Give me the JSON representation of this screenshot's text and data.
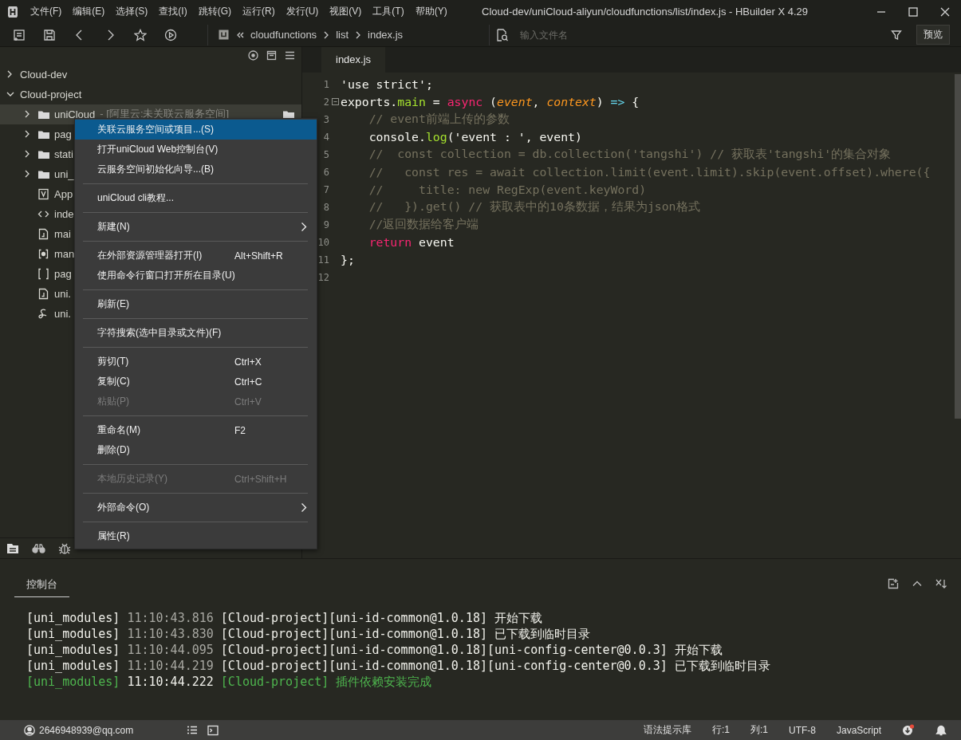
{
  "window": {
    "title": "Cloud-dev/uniCloud-aliyun/cloudfunctions/list/index.js - HBuilder X 4.29"
  },
  "menu_bar": [
    "文件(F)",
    "编辑(E)",
    "选择(S)",
    "查找(I)",
    "跳转(G)",
    "运行(R)",
    "发行(U)",
    "视图(V)",
    "工具(T)",
    "帮助(Y)"
  ],
  "toolbar": {
    "breadcrumb": [
      "cloudfunctions",
      "list",
      "index.js"
    ],
    "search": {
      "placeholder": "输入文件名"
    },
    "preview_button": "预览"
  },
  "tree": [
    {
      "label": "Cloud-dev",
      "expanded": false,
      "selected": false
    },
    {
      "label": "Cloud-project",
      "expanded": true,
      "selected": false,
      "children": [
        {
          "label": "uniCloud",
          "note": "- [阿里云:未关联云服务空间]",
          "kind": "folder",
          "expanded": false,
          "selected": true
        },
        {
          "label": "pag",
          "kind": "folder",
          "expanded": false,
          "selected": false
        },
        {
          "label": "stati",
          "kind": "folder",
          "expanded": false,
          "selected": false
        },
        {
          "label": "uni_",
          "kind": "folder",
          "expanded": false,
          "selected": false
        },
        {
          "label": "App",
          "kind": "vue",
          "selected": false
        },
        {
          "label": "inde",
          "kind": "html",
          "selected": false
        },
        {
          "label": "mai",
          "kind": "js",
          "selected": false
        },
        {
          "label": "man",
          "kind": "manifest",
          "selected": false
        },
        {
          "label": "pag",
          "kind": "json",
          "selected": false
        },
        {
          "label": "uni.",
          "kind": "js",
          "selected": false
        },
        {
          "label": "uni.",
          "kind": "style",
          "selected": false
        }
      ]
    }
  ],
  "context_menu": [
    {
      "kind": "item",
      "label": "关联云服务空间或项目...(S)",
      "submenu": false,
      "disabled": false,
      "selected": true
    },
    {
      "kind": "item",
      "label": "打开uniCloud Web控制台(V)",
      "submenu": false,
      "disabled": false,
      "selected": false
    },
    {
      "kind": "item",
      "label": "云服务空间初始化向导...(B)",
      "submenu": false,
      "disabled": false,
      "selected": false
    },
    {
      "kind": "separator"
    },
    {
      "kind": "item",
      "label": "uniCloud cli教程...",
      "submenu": false,
      "disabled": false,
      "selected": false
    },
    {
      "kind": "separator"
    },
    {
      "kind": "item",
      "label": "新建(N)",
      "submenu": true,
      "disabled": false,
      "selected": false
    },
    {
      "kind": "separator"
    },
    {
      "kind": "item",
      "label": "在外部资源管理器打开(I)",
      "shortcut": "Alt+Shift+R",
      "submenu": false,
      "disabled": false,
      "selected": false
    },
    {
      "kind": "item",
      "label": "使用命令行窗口打开所在目录(U)",
      "submenu": false,
      "disabled": false,
      "selected": false
    },
    {
      "kind": "separator"
    },
    {
      "kind": "item",
      "label": "刷新(E)",
      "submenu": false,
      "disabled": false,
      "selected": false
    },
    {
      "kind": "separator"
    },
    {
      "kind": "item",
      "label": "字符搜索(选中目录或文件)(F)",
      "submenu": false,
      "disabled": false,
      "selected": false
    },
    {
      "kind": "separator"
    },
    {
      "kind": "item",
      "label": "剪切(T)",
      "shortcut": "Ctrl+X",
      "submenu": false,
      "disabled": false,
      "selected": false
    },
    {
      "kind": "item",
      "label": "复制(C)",
      "shortcut": "Ctrl+C",
      "submenu": false,
      "disabled": false,
      "selected": false
    },
    {
      "kind": "item",
      "label": "粘贴(P)",
      "shortcut": "Ctrl+V",
      "submenu": false,
      "disabled": true,
      "selected": false
    },
    {
      "kind": "separator"
    },
    {
      "kind": "item",
      "label": "重命名(M)",
      "shortcut": "F2",
      "submenu": false,
      "disabled": false,
      "selected": false
    },
    {
      "kind": "item",
      "label": "删除(D)",
      "submenu": false,
      "disabled": false,
      "selected": false
    },
    {
      "kind": "separator"
    },
    {
      "kind": "item",
      "label": "本地历史记录(Y)",
      "shortcut": "Ctrl+Shift+H",
      "submenu": false,
      "disabled": true,
      "selected": false
    },
    {
      "kind": "separator"
    },
    {
      "kind": "item",
      "label": "外部命令(O)",
      "submenu": true,
      "disabled": false,
      "selected": false
    },
    {
      "kind": "separator"
    },
    {
      "kind": "item",
      "label": "属性(R)",
      "submenu": false,
      "disabled": false,
      "selected": false
    }
  ],
  "editor": {
    "tabs": [
      {
        "label": "index.js",
        "selected": true
      }
    ],
    "lines": [
      {
        "number": "1",
        "fold": false,
        "tokens": [
          {
            "kind": "plain",
            "text": "'use strict';"
          }
        ]
      },
      {
        "number": "2",
        "fold": true,
        "tokens": [
          {
            "kind": "plain",
            "text": "exports."
          },
          {
            "kind": "func",
            "text": "main"
          },
          {
            "kind": "plain",
            "text": " = "
          },
          {
            "kind": "keyword",
            "text": "async"
          },
          {
            "kind": "plain",
            "text": " ("
          },
          {
            "kind": "param",
            "text": "event"
          },
          {
            "kind": "plain",
            "text": ", "
          },
          {
            "kind": "param",
            "text": "context"
          },
          {
            "kind": "plain",
            "text": ") "
          },
          {
            "kind": "operator",
            "text": "=>"
          },
          {
            "kind": "plain",
            "text": " {"
          }
        ]
      },
      {
        "number": "3",
        "fold": false,
        "tokens": [
          {
            "kind": "comment",
            "text": "    // event前端上传的参数"
          }
        ]
      },
      {
        "number": "4",
        "fold": false,
        "tokens": [
          {
            "kind": "plain",
            "text": "    console."
          },
          {
            "kind": "func",
            "text": "log"
          },
          {
            "kind": "plain",
            "text": "('event : ', event)"
          }
        ]
      },
      {
        "number": "5",
        "fold": false,
        "tokens": [
          {
            "kind": "comment",
            "text": "    //  const collection = db.collection('tangshi') // 获取表'tangshi'的集合对象"
          }
        ]
      },
      {
        "number": "6",
        "fold": false,
        "tokens": [
          {
            "kind": "comment",
            "text": "    //   const res = await collection.limit(event.limit).skip(event.offset).where({"
          }
        ]
      },
      {
        "number": "7",
        "fold": false,
        "tokens": [
          {
            "kind": "comment",
            "text": "    //     title: new RegExp(event.keyWord)"
          }
        ]
      },
      {
        "number": "8",
        "fold": false,
        "tokens": [
          {
            "kind": "comment",
            "text": "    //   }).get() // 获取表中的10条数据，结果为json格式"
          }
        ]
      },
      {
        "number": "9",
        "fold": false,
        "tokens": [
          {
            "kind": "comment",
            "text": "    //返回数据给客户端"
          }
        ]
      },
      {
        "number": "10",
        "fold": false,
        "tokens": [
          {
            "kind": "keyword",
            "text": "    return"
          },
          {
            "kind": "plain",
            "text": " event"
          }
        ]
      },
      {
        "number": "11",
        "fold": false,
        "tokens": [
          {
            "kind": "plain",
            "text": "};"
          }
        ]
      },
      {
        "number": "12",
        "fold": false
      }
    ]
  },
  "console": {
    "tabs": [
      {
        "label": "控制台",
        "selected": true
      }
    ],
    "lines": [
      {
        "tag": "[uni_modules]",
        "time": "11:10:43.816",
        "message": "[Cloud-project][uni-id-common@1.0.18] 开始下载",
        "success": false
      },
      {
        "tag": "[uni_modules]",
        "time": "11:10:43.830",
        "message": "[Cloud-project][uni-id-common@1.0.18] 已下载到临时目录",
        "success": false
      },
      {
        "tag": "[uni_modules]",
        "time": "11:10:44.095",
        "message": "[Cloud-project][uni-id-common@1.0.18][uni-config-center@0.0.3] 开始下载",
        "success": false
      },
      {
        "tag": "[uni_modules]",
        "time": "11:10:44.219",
        "message": "[Cloud-project][uni-id-common@1.0.18][uni-config-center@0.0.3] 已下载到临时目录",
        "success": false
      },
      {
        "tag": "[uni_modules]",
        "time": "11:10:44.222",
        "message": "[Cloud-project] 插件依赖安装完成",
        "success": true
      }
    ]
  },
  "status_bar": {
    "account": "2646948939@qq.com",
    "items": [
      "语法提示库",
      "行:1",
      "列:1",
      "UTF-8",
      "JavaScript"
    ]
  }
}
